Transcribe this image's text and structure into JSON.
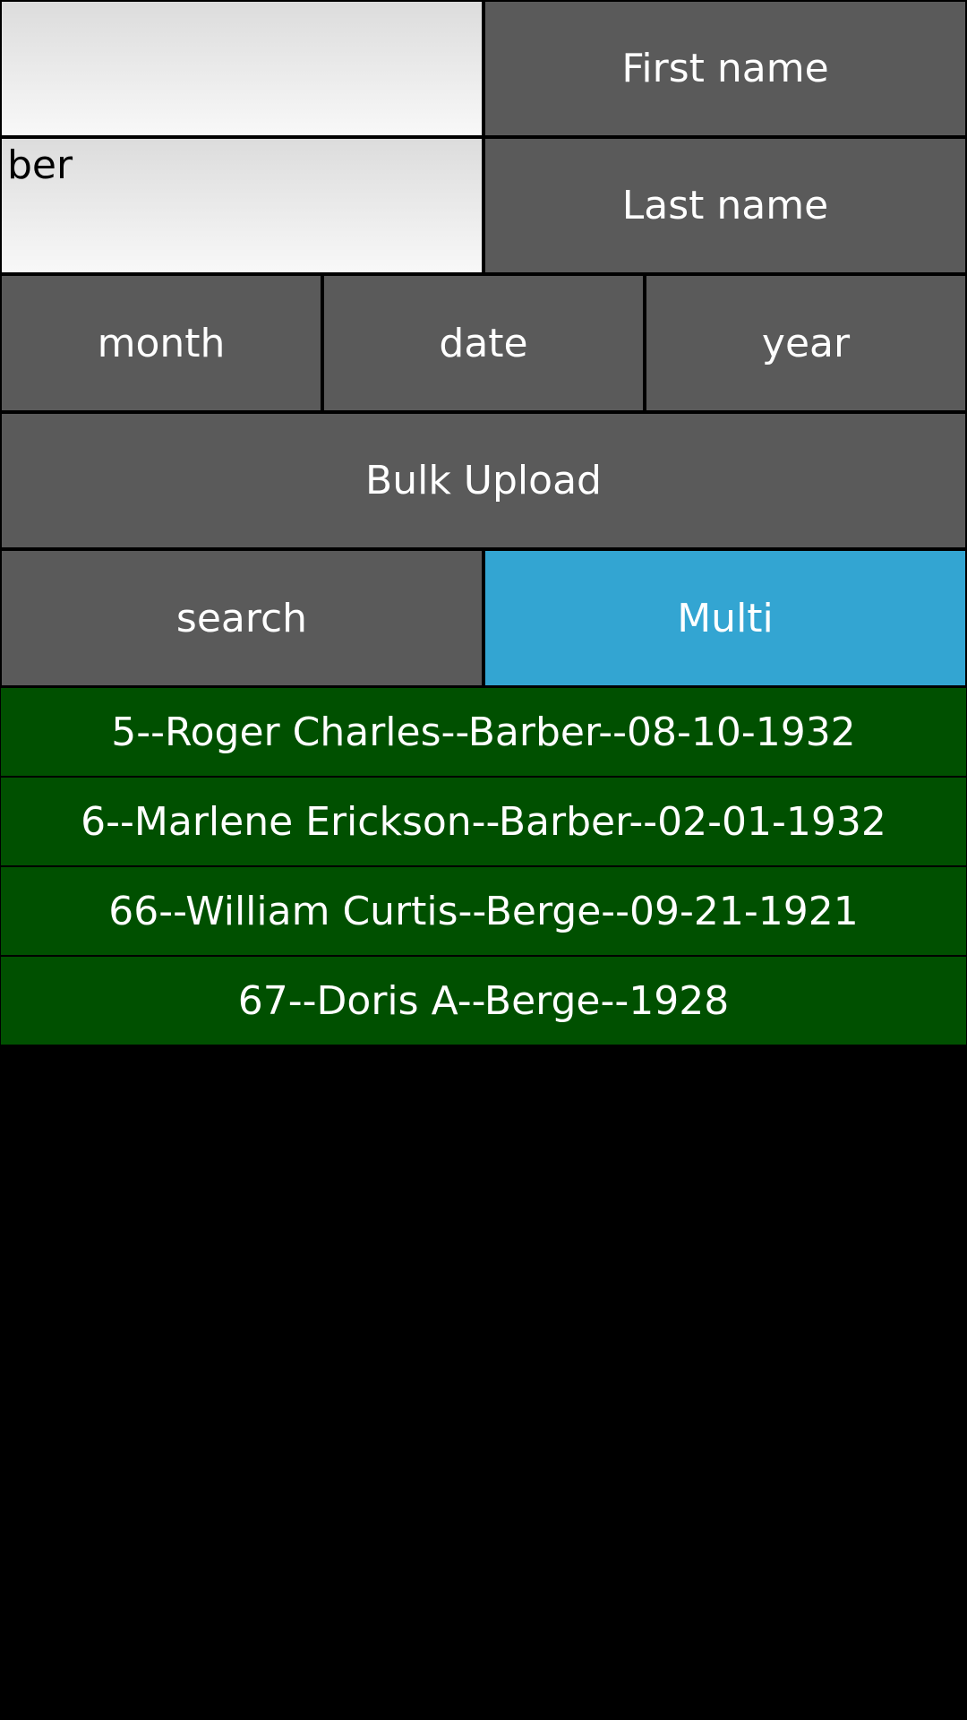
{
  "colors": {
    "background": "#000000",
    "button": "#5a5a5a",
    "accent": "#33a5d2",
    "result": "#005000"
  },
  "first_name": {
    "value": "",
    "button_label": "First name"
  },
  "last_name": {
    "value": "ber",
    "button_label": "Last name"
  },
  "date_buttons": {
    "month_label": "month",
    "date_label": "date",
    "year_label": "year"
  },
  "bulk_upload": {
    "label": "Bulk Upload"
  },
  "actions": {
    "search_label": "search",
    "multi_label": "Multi"
  },
  "results": [
    "5--Roger Charles--Barber--08-10-1932",
    "6--Marlene Erickson--Barber--02-01-1932",
    "66--William Curtis--Berge--09-21-1921",
    "67--Doris A--Berge--1928"
  ]
}
